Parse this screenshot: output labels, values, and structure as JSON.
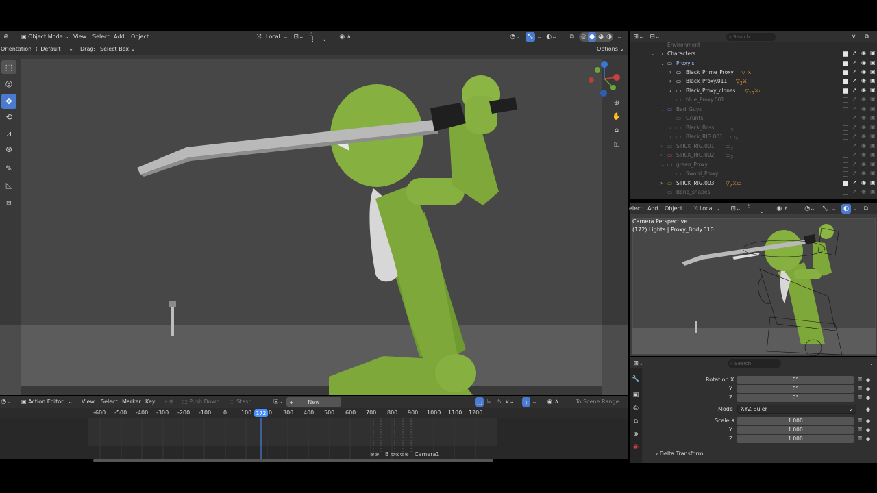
{
  "viewport_header": {
    "mode": "Object Mode",
    "menus": [
      "View",
      "Select",
      "Add",
      "Object"
    ],
    "transform_orientation": "Local",
    "options_label": "Options"
  },
  "tool_settings": {
    "orientation_label": "Orientation:",
    "orientation_value": "Default",
    "drag_label": "Drag:",
    "drag_value": "Select Box"
  },
  "toolbar": {
    "tools": [
      "select-box",
      "cursor",
      "move",
      "rotate",
      "scale",
      "transform",
      "annotate",
      "measure",
      "add-cube"
    ]
  },
  "nav_gizmo": {
    "axes": [
      "X",
      "Y",
      "Z"
    ]
  },
  "outliner": {
    "search_placeholder": "Search",
    "rows": [
      {
        "name": "Environment",
        "dim": true
      },
      {
        "name": "Characters",
        "dim": false
      },
      {
        "name": "Proxy's",
        "dim": false,
        "color": "#9fc2ff"
      },
      {
        "name": "Black_Prime_Proxy",
        "dim": false
      },
      {
        "name": "Black_Proxy.011",
        "dim": false,
        "count": "2"
      },
      {
        "name": "Black_Proxy_clones",
        "dim": false,
        "count": "10"
      },
      {
        "name": "blue_Proxy.001",
        "dim": true
      },
      {
        "name": "Bad_Guys",
        "dim": true
      },
      {
        "name": "Grunts",
        "dim": true
      },
      {
        "name": "Black_Boss",
        "dim": true,
        "count": "3"
      },
      {
        "name": "Black_RIG.001",
        "dim": true,
        "count": "3"
      },
      {
        "name": "STICK_RIG.001",
        "dim": true,
        "count": "3"
      },
      {
        "name": "STICK_RIG.002",
        "dim": true,
        "count": "3"
      },
      {
        "name": "green_Proxy",
        "dim": true
      },
      {
        "name": "Sword_Proxy",
        "dim": true
      },
      {
        "name": "STICK_RIG.003",
        "dim": false,
        "count": "7"
      },
      {
        "name": "Bone_shapes",
        "dim": true
      }
    ]
  },
  "camera_view": {
    "menus": [
      "elect",
      "Add",
      "Object"
    ],
    "orientation": "Local",
    "title": "Camera Perspective",
    "subtitle": "(172) Lights | Proxy_Body.010"
  },
  "properties": {
    "search_placeholder": "Search",
    "rotation_label": "Rotation X",
    "rotation": {
      "x": "0°",
      "y": "0°",
      "z": "0°"
    },
    "mode_label": "Mode",
    "mode_value": "XYZ Euler",
    "scale_label": "Scale X",
    "scale": {
      "x": "1.000",
      "y": "1.000",
      "z": "1.000"
    },
    "axis_y": "Y",
    "axis_z": "Z",
    "delta_label": "Delta Transform"
  },
  "action_editor": {
    "mode": "Action Editor",
    "menus": [
      "View",
      "Select",
      "Marker",
      "Key"
    ],
    "push_down": "Push Down",
    "stash": "Stash",
    "new_label": "New",
    "scene_range": "To Scene Range",
    "frame_ticks": [
      "-600",
      "-500",
      "-400",
      "-300",
      "-200",
      "-100",
      "0",
      "100",
      "0",
      "300",
      "400",
      "500",
      "600",
      "700",
      "800",
      "900",
      "1000",
      "1100",
      "1200"
    ],
    "current_frame": "172",
    "marker_label": "Camera1",
    "marker_b": "B"
  },
  "colors": {
    "character_green": "#7fa83a",
    "accent_blue": "#4a7bd0",
    "playhead_blue": "#4a90ff"
  }
}
